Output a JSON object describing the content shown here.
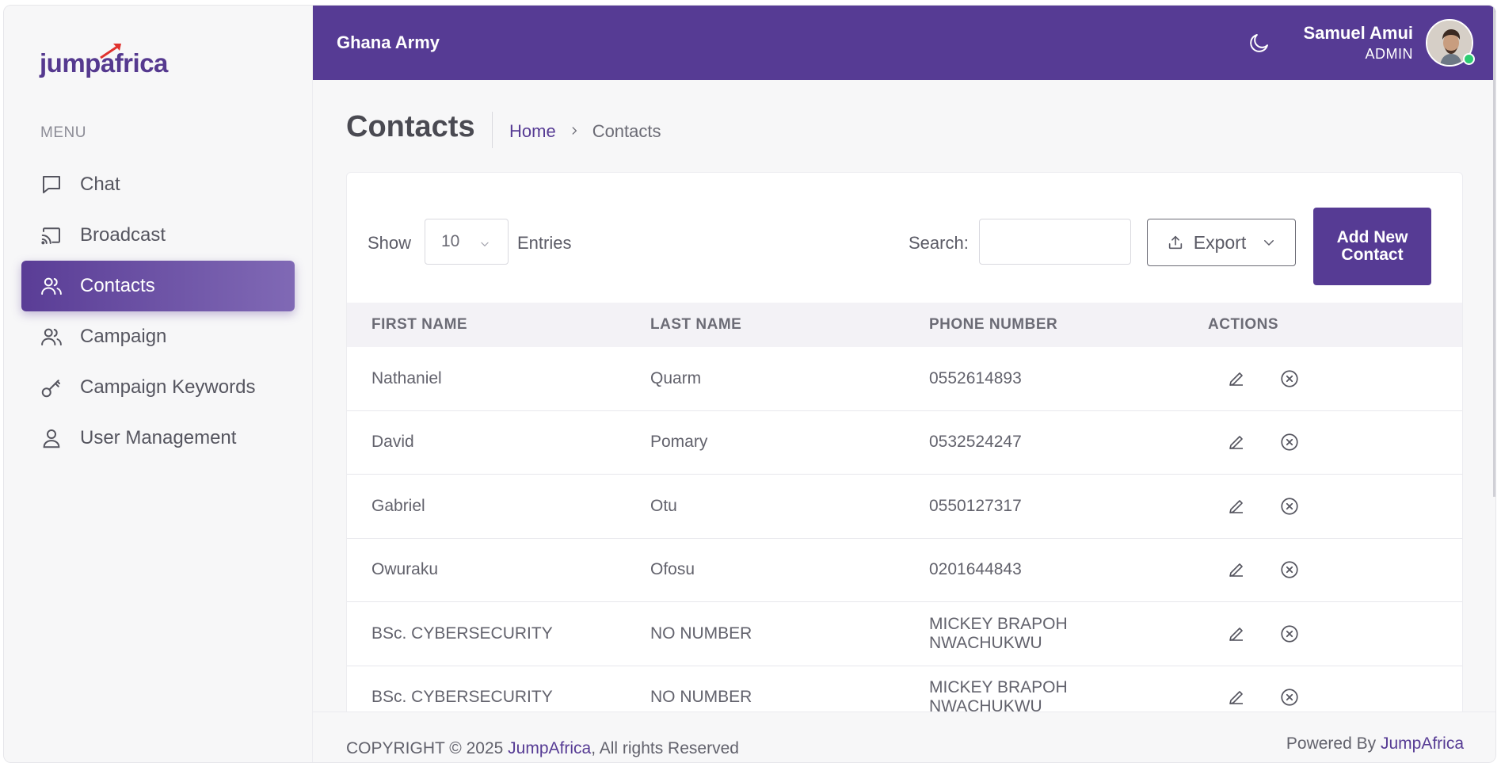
{
  "brand": {
    "logo_text_pre": "jump",
    "logo_text_a": "a",
    "logo_text_post": "frica"
  },
  "sidebar": {
    "menu_heading": "MENU",
    "items": [
      {
        "label": "Chat",
        "icon": "chat-icon",
        "active": false
      },
      {
        "label": "Broadcast",
        "icon": "broadcast-icon",
        "active": false
      },
      {
        "label": "Contacts",
        "icon": "users-icon",
        "active": true
      },
      {
        "label": "Campaign",
        "icon": "users-icon",
        "active": false
      },
      {
        "label": "Campaign Keywords",
        "icon": "key-icon",
        "active": false
      },
      {
        "label": "User Management",
        "icon": "user-icon",
        "active": false
      }
    ]
  },
  "header": {
    "org_name": "Ghana Army",
    "user_name": "Samuel Amui",
    "user_role": "ADMIN",
    "theme_icon": "moon-icon"
  },
  "page": {
    "title": "Contacts",
    "breadcrumb": {
      "home": "Home",
      "current": "Contacts"
    }
  },
  "toolbar": {
    "show_label": "Show",
    "entries_value": "10",
    "entries_label": "Entries",
    "search_label": "Search:",
    "search_value": "",
    "export_label": "Export",
    "add_label": "Add New Contact"
  },
  "table": {
    "headers": [
      "FIRST NAME",
      "LAST NAME",
      "PHONE NUMBER",
      "ACTIONS"
    ],
    "rows": [
      {
        "first": "Nathaniel",
        "last": "Quarm",
        "phone": "0552614893"
      },
      {
        "first": "David",
        "last": "Pomary",
        "phone": "0532524247"
      },
      {
        "first": "Gabriel",
        "last": "Otu",
        "phone": "0550127317"
      },
      {
        "first": "Owuraku",
        "last": "Ofosu",
        "phone": "0201644843"
      },
      {
        "first": "BSc. CYBERSECURITY",
        "last": "NO NUMBER",
        "phone": "MICKEY BRAPOH NWACHUKWU"
      },
      {
        "first": "BSc. CYBERSECURITY",
        "last": "NO NUMBER",
        "phone": "MICKEY BRAPOH NWACHUKWU"
      }
    ]
  },
  "footer": {
    "copyright_pre": "COPYRIGHT © 2025 ",
    "copyright_brand": "JumpAfrica",
    "copyright_post": ", All rights Reserved",
    "powered_pre": "Powered By ",
    "powered_brand": "JumpAfrica"
  },
  "colors": {
    "brand": "#563b94",
    "online": "#2ecc71"
  }
}
